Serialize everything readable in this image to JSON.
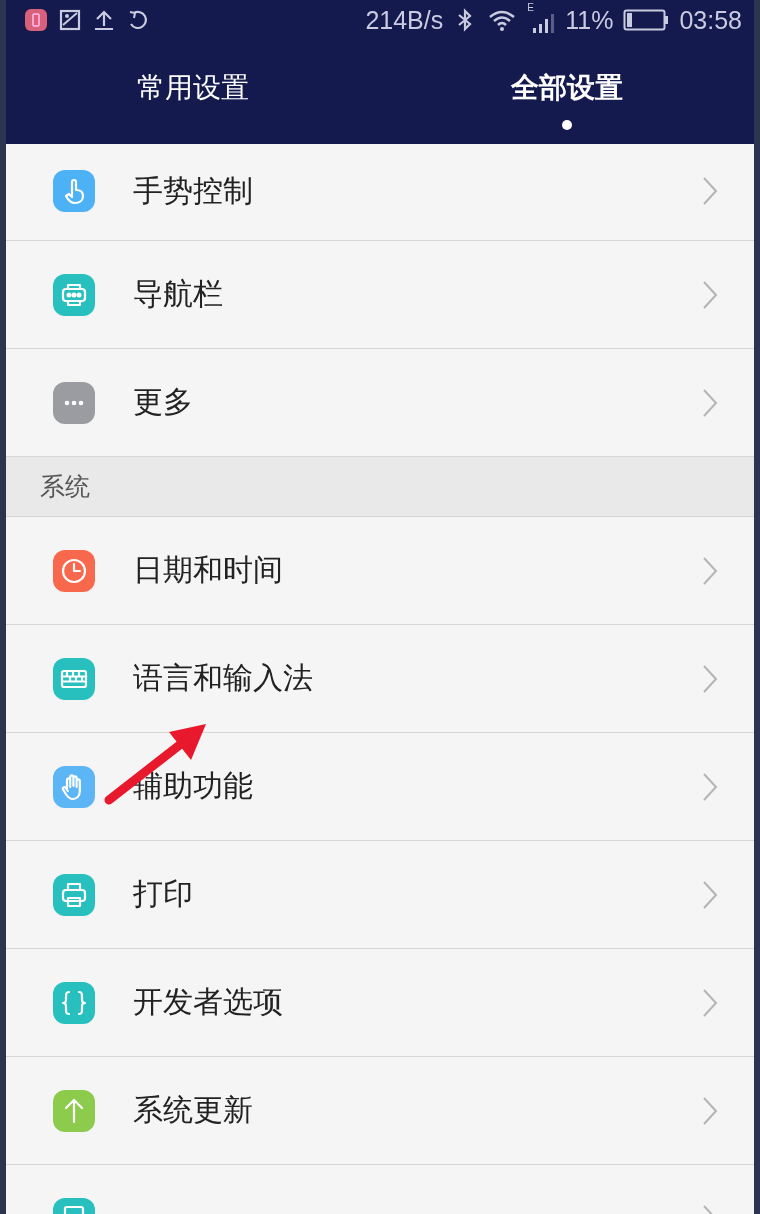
{
  "status_bar": {
    "speed": "214B/s",
    "network": "E",
    "battery": "11%",
    "time": "03:58"
  },
  "tabs": [
    {
      "label": "常用设置",
      "selected": false
    },
    {
      "label": "全部设置",
      "selected": true
    }
  ],
  "sections": [
    {
      "items": [
        {
          "label": "手势控制",
          "color": "#4db1f5"
        },
        {
          "label": "导航栏",
          "color": "#27c0bf"
        },
        {
          "label": "更多",
          "color": "#9b9ca2"
        }
      ]
    },
    {
      "header": "系统",
      "items": [
        {
          "label": "日期和时间",
          "color": "#f8684c"
        },
        {
          "label": "语言和输入法",
          "color": "#27c0bf"
        },
        {
          "label": "辅助功能",
          "color": "#5cb5f4"
        },
        {
          "label": "打印",
          "color": "#27c0bf"
        },
        {
          "label": "开发者选项",
          "color": "#27c0bf"
        },
        {
          "label": "系统更新",
          "color": "#8ccb4c"
        },
        {
          "color": "#27c0bf"
        }
      ]
    }
  ]
}
